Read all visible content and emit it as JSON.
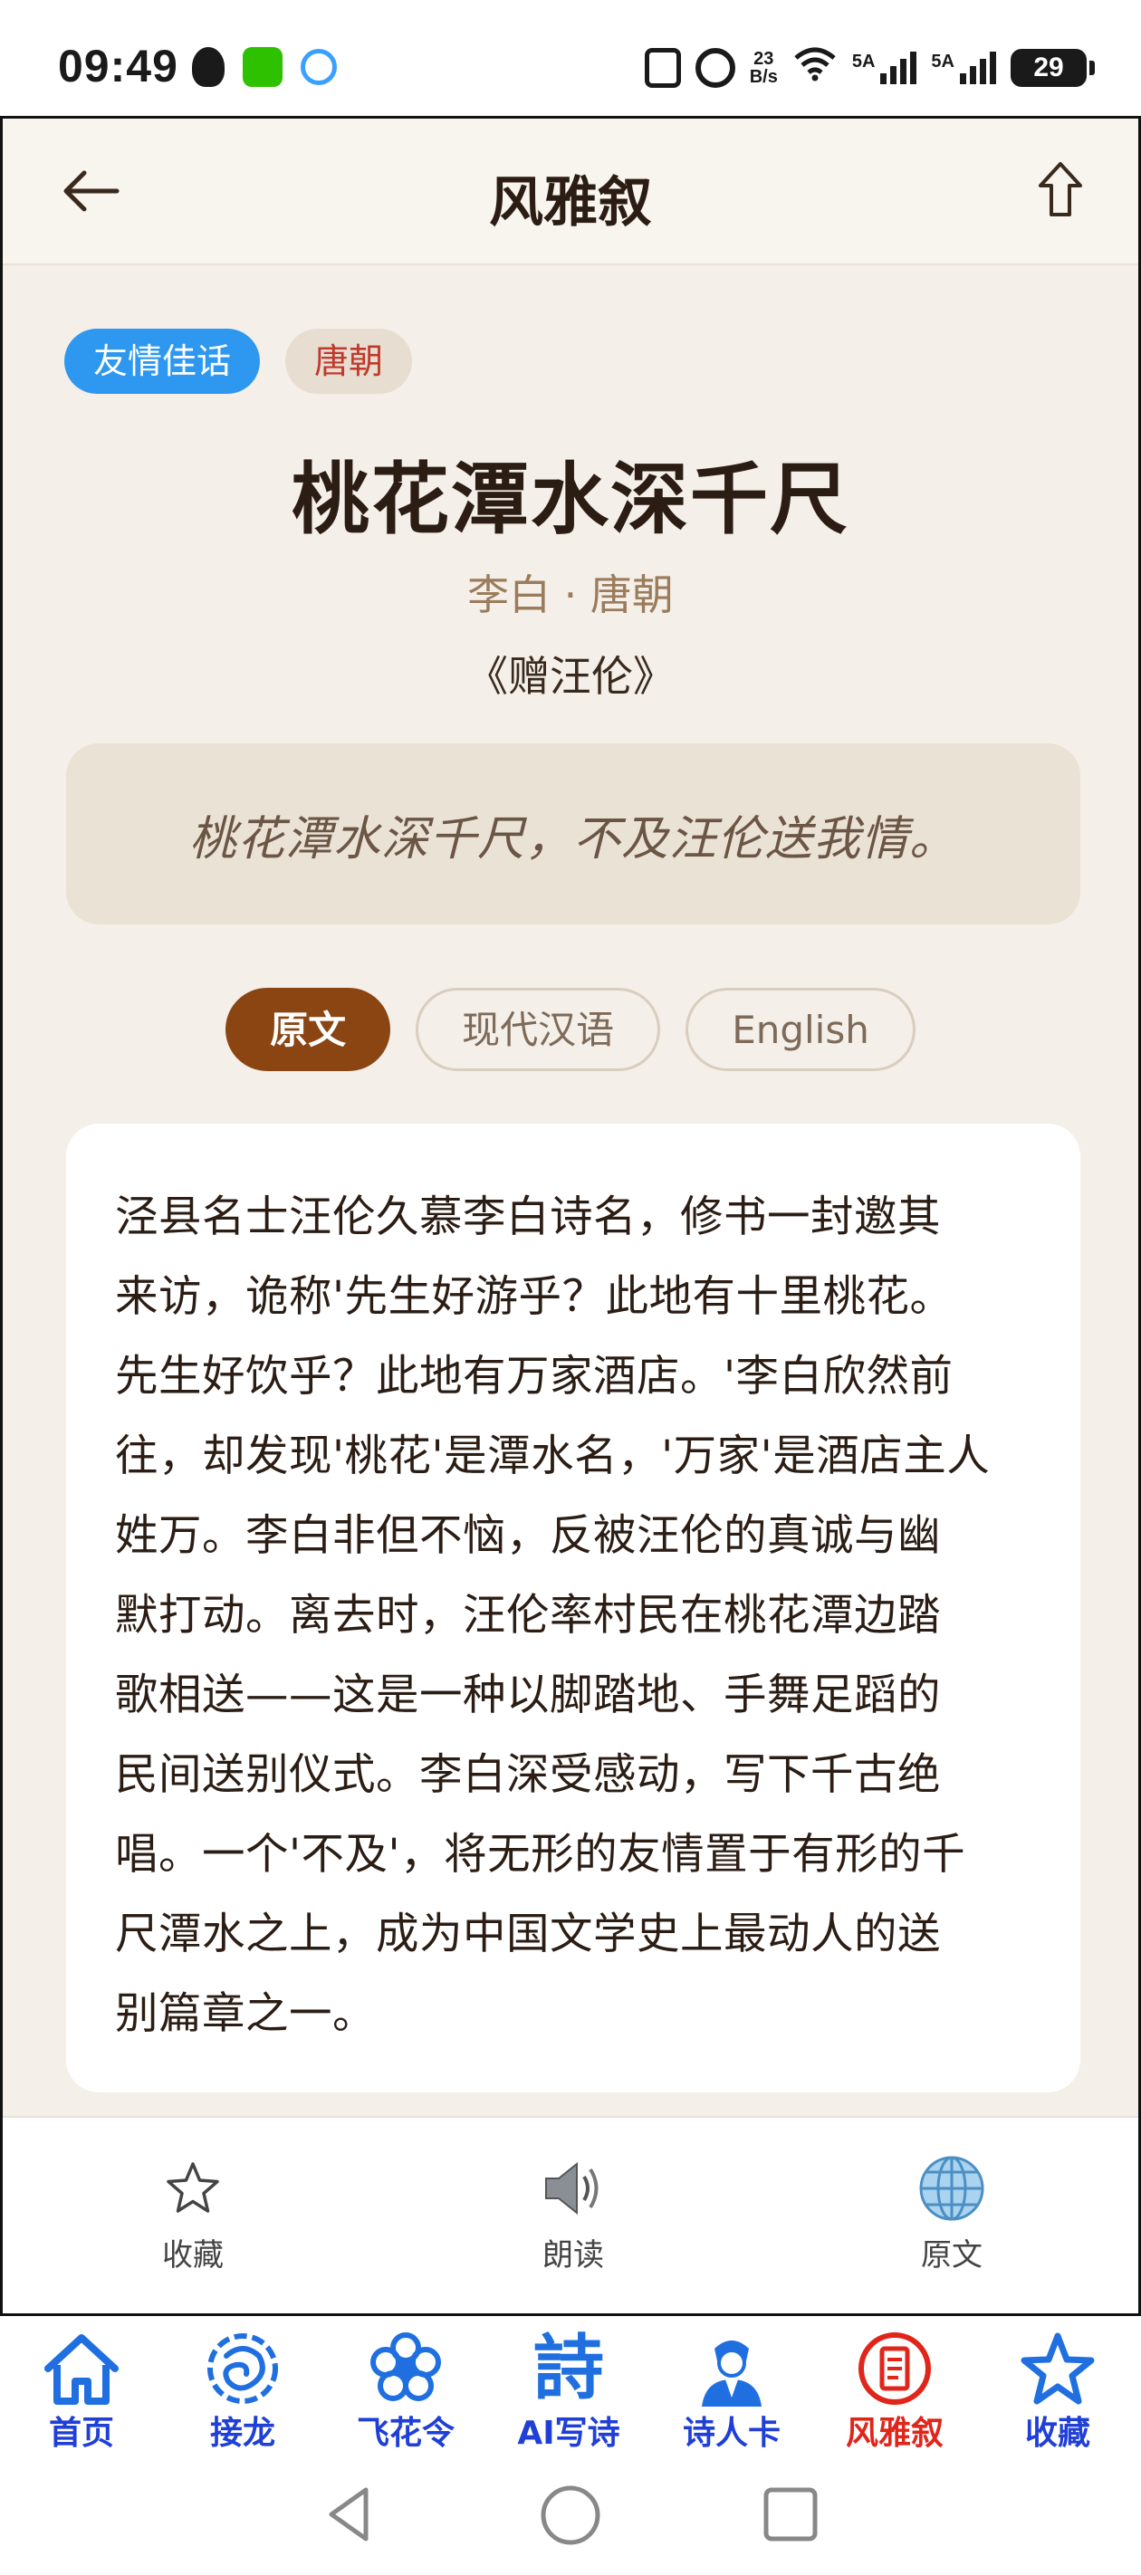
{
  "status_bar": {
    "time": "09:49",
    "net_speed_top": "23",
    "net_speed_bottom": "B/s",
    "signal1_label": "5A",
    "signal2_label": "5A",
    "battery": "29"
  },
  "header": {
    "title": "风雅叙"
  },
  "tags": [
    "友情佳话",
    "唐朝"
  ],
  "poem": {
    "title": "桃花潭水深千尺",
    "author_line": "李白 · 唐朝",
    "work": "《赠汪伦》",
    "quote": "桃花潭水深千尺，不及汪伦送我情。"
  },
  "lang_tabs": [
    {
      "label": "原文",
      "active": true
    },
    {
      "label": "现代汉语",
      "active": false
    },
    {
      "label": "English",
      "active": false
    }
  ],
  "content_lines": [
    "泾县名士汪伦久慕李白诗名，修书一封邀其",
    "来访，诡称'先生好游乎？此地有十里桃花。",
    "先生好饮乎？此地有万家酒店。'李白欣然前",
    "往，却发现'桃花'是潭水名，'万家'是酒店主人",
    "姓万。李白非但不恼，反被汪伦的真诚与幽",
    "默打动。离去时，汪伦率村民在桃花潭边踏",
    "歌相送——这是一种以脚踏地、手舞足蹈的",
    "民间送别仪式。李白深受感动，写下千古绝",
    "唱。一个'不及'，将无形的友情置于有形的千",
    "尺潭水之上，成为中国文学史上最动人的送",
    "别篇章之一。"
  ],
  "actions": [
    {
      "label": "收藏",
      "icon": "star-outline-icon"
    },
    {
      "label": "朗读",
      "icon": "speaker-icon"
    },
    {
      "label": "原文",
      "icon": "globe-icon"
    }
  ],
  "bottom_nav": [
    {
      "label": "首页",
      "icon": "home-icon"
    },
    {
      "label": "接龙",
      "icon": "dragon-icon"
    },
    {
      "label": "飞花令",
      "icon": "flower-icon"
    },
    {
      "label": "AI写诗",
      "icon": "poem-char-icon",
      "glyph": "詩"
    },
    {
      "label": "诗人卡",
      "icon": "poet-portrait-icon"
    },
    {
      "label": "风雅叙",
      "icon": "scroll-badge-icon",
      "active": true
    },
    {
      "label": "收藏",
      "icon": "star-icon"
    }
  ],
  "colors": {
    "page_bg": "#f4efe8",
    "accent_brown": "#8b4513",
    "tag_blue": "#2e98f0",
    "tag_red_text": "#c0392b",
    "nav_blue": "#1f3fd6",
    "nav_active_red": "#e0251b"
  }
}
